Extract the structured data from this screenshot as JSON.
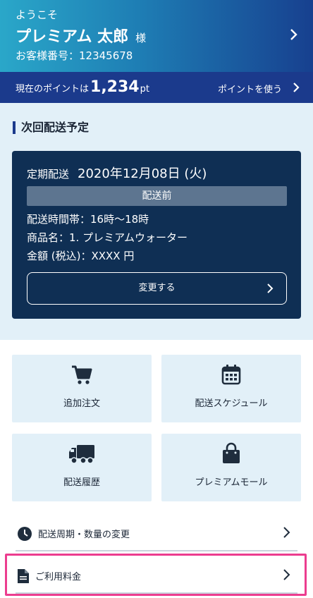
{
  "header": {
    "welcome": "ようこそ",
    "user_name": "プレミアム 太郎",
    "honorific": "様",
    "customer_number": "お客様番号：12345678"
  },
  "points": {
    "label": "現在のポイントは",
    "value": "1,234",
    "unit": "pt",
    "use_label": "ポイントを使う"
  },
  "next_delivery": {
    "section_title": "次回配送予定",
    "type_label": "定期配送",
    "date": "2020年12月08日 (火)",
    "status": "配送前",
    "time_slot": "配送時間帯：16時～18時",
    "product": "商品名：1. プレミアムウォーター",
    "amount": "金額 (税込)：XXXX 円",
    "change_button": "変更する"
  },
  "tiles": [
    {
      "label": "追加注文",
      "icon": "cart-icon"
    },
    {
      "label": "配送スケジュール",
      "icon": "calendar-icon"
    },
    {
      "label": "配送履歴",
      "icon": "truck-icon"
    },
    {
      "label": "プレミアムモール",
      "icon": "shopping-bag-icon"
    }
  ],
  "list": [
    {
      "label": "配送周期・数量の変更",
      "icon": "clock-icon"
    },
    {
      "label": "ご利用料金",
      "icon": "document-icon"
    }
  ],
  "colors": {
    "header_gradient_start": "#2aa7c9",
    "header_gradient_end": "#17408f",
    "points_bar": "#1b3a8c",
    "card_navy": "#0f2f54",
    "section_bg": "#e2f0f8",
    "highlight": "#ec3d8f"
  }
}
